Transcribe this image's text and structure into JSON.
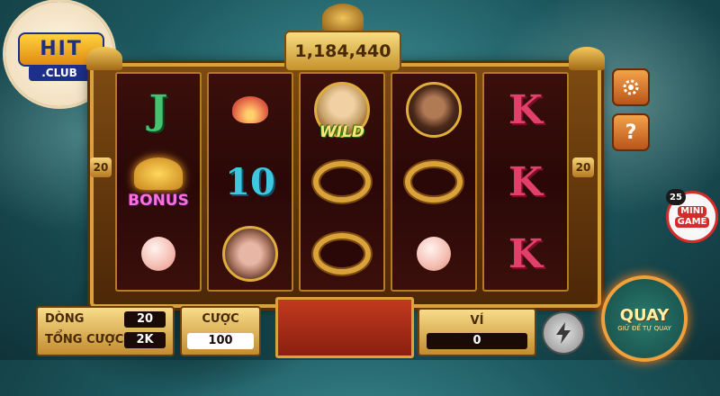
{
  "jackpot": {
    "value": "1,184,440"
  },
  "side_numbers": {
    "left": "20",
    "right": "20"
  },
  "reels": [
    {
      "symbols": [
        "J",
        "bonus",
        "peach"
      ]
    },
    {
      "symbols": [
        "lotus",
        "10",
        "pig-portrait"
      ]
    },
    {
      "symbols": [
        "wild-monk",
        "ring",
        "ring"
      ]
    },
    {
      "symbols": [
        "warrior-portrait",
        "ring",
        "peach"
      ]
    },
    {
      "symbols": [
        "K",
        "K",
        "K"
      ]
    }
  ],
  "symbol_text": {
    "j": "J",
    "k": "K",
    "ten": "10",
    "wild": "WILD",
    "bonus": "BONUS"
  },
  "logo": {
    "main": "HIT",
    "sub": ".CLUB"
  },
  "mini_game": {
    "label_top": "MINI",
    "label_bottom": "GAME",
    "badge": "25"
  },
  "bottom": {
    "lines_label": "DÒNG",
    "lines_value": "20",
    "total_bet_label": "TỔNG CƯỢC",
    "total_bet_value": "2K",
    "bet_label": "CƯỢC",
    "bet_value": "100",
    "wallet_label": "VÍ",
    "wallet_value": "0",
    "spin_label": "QUAY",
    "spin_sub": "GIỮ ĐỂ TỰ QUAY"
  },
  "icons": {
    "settings": "gear-icon",
    "help": "question-icon",
    "turbo": "lightning-icon"
  },
  "colors": {
    "frame_gold": "#d9a23a",
    "reel_bg": "#2a0807",
    "accent_red": "#d62b2b"
  }
}
